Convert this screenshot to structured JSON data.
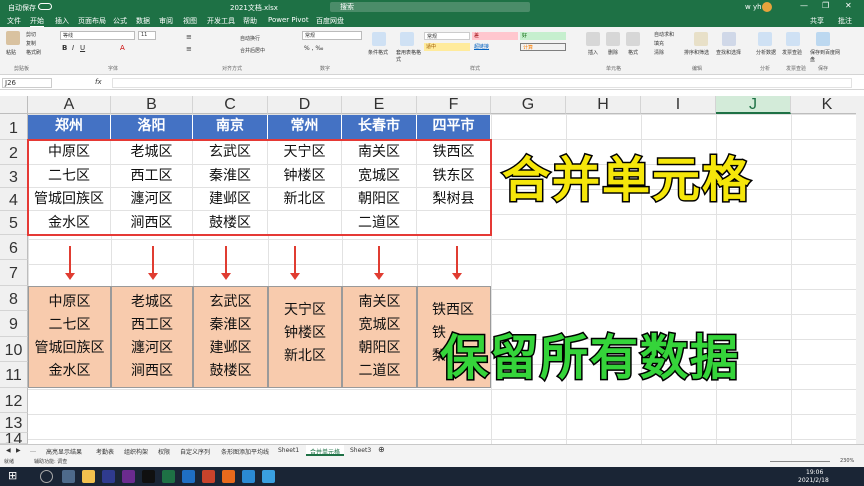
{
  "titlebar": {
    "autosave": "自动保存",
    "filename": "2021文档.xlsx",
    "search": "搜索",
    "user": "w yh"
  },
  "menu": [
    "文件",
    "开始",
    "插入",
    "页面布局",
    "公式",
    "数据",
    "审阅",
    "视图",
    "开发工具",
    "帮助",
    "Power Pivot",
    "百度网盘"
  ],
  "menu_right": [
    "共享",
    "批注"
  ],
  "ribbon": {
    "clipboard": [
      "剪切",
      "复制",
      "格式刷",
      "粘贴"
    ],
    "groups": [
      "剪贴板",
      "字体",
      "对齐方式",
      "数字",
      "样式",
      "单元格",
      "编辑",
      "分析",
      "发票查验",
      "保存"
    ],
    "font_name": "等线",
    "font_size": "11",
    "styles": {
      "normal": "常规",
      "bad": "差",
      "good": "好",
      "neutral": "适中",
      "hyperlink": "超链接",
      "calc": "计算"
    },
    "buttons": [
      "条件格式",
      "套用表格格式",
      "插入",
      "删除",
      "格式",
      "自动求和",
      "填充",
      "清除",
      "排序和筛选",
      "查找和选择",
      "分析数据",
      "发票查验",
      "保存到百度网盘"
    ],
    "align": [
      "自动换行",
      "合并后居中"
    ],
    "number_format": "常规"
  },
  "formula_bar": {
    "namebox": "J26",
    "fx": "fx"
  },
  "columns": [
    "A",
    "B",
    "C",
    "D",
    "E",
    "F",
    "G",
    "H",
    "I",
    "J",
    "K"
  ],
  "rows": [
    "1",
    "2",
    "3",
    "4",
    "5",
    "6",
    "7",
    "8",
    "9",
    "10",
    "11",
    "12",
    "13",
    "14"
  ],
  "table_header": [
    "郑州",
    "洛阳",
    "南京",
    "常州",
    "长春市",
    "四平市"
  ],
  "table_rows": [
    [
      "中原区",
      "老城区",
      "玄武区",
      "天宁区",
      "南关区",
      "铁西区"
    ],
    [
      "二七区",
      "西工区",
      "秦淮区",
      "钟楼区",
      "宽城区",
      "铁东区"
    ],
    [
      "管城回族区",
      "瀍河区",
      "建邺区",
      "新北区",
      "朝阳区",
      "梨树县"
    ],
    [
      "金水区",
      "涧西区",
      "鼓楼区",
      "",
      "二道区",
      ""
    ]
  ],
  "merged": [
    [
      "中原区",
      "二七区",
      "管城回族区",
      "金水区"
    ],
    [
      "老城区",
      "西工区",
      "瀍河区",
      "涧西区"
    ],
    [
      "玄武区",
      "秦淮区",
      "建邺区",
      "鼓楼区"
    ],
    [
      "天宁区",
      "钟楼区",
      "新北区"
    ],
    [
      "南关区",
      "宽城区",
      "朝阳区",
      "二道区"
    ],
    [
      "铁西区",
      "铁",
      "梨"
    ]
  ],
  "overlay": {
    "title1": "合并单元格",
    "title2": "保留所有数据",
    "color1": "#f5e60a",
    "color2": "#35d43a"
  },
  "sheet_tabs": [
    "高亮显示结果",
    "考勤表",
    "组织构架",
    "权限",
    "自定义序列",
    "条形图添加平均线",
    "Sheet1",
    "合并单元格",
    "Sheet3"
  ],
  "status": {
    "left": "就绪",
    "accessibility": "辅助功能: 调查",
    "zoom": "230%"
  },
  "clock": {
    "time": "19:06",
    "date": "2021/2/18"
  }
}
